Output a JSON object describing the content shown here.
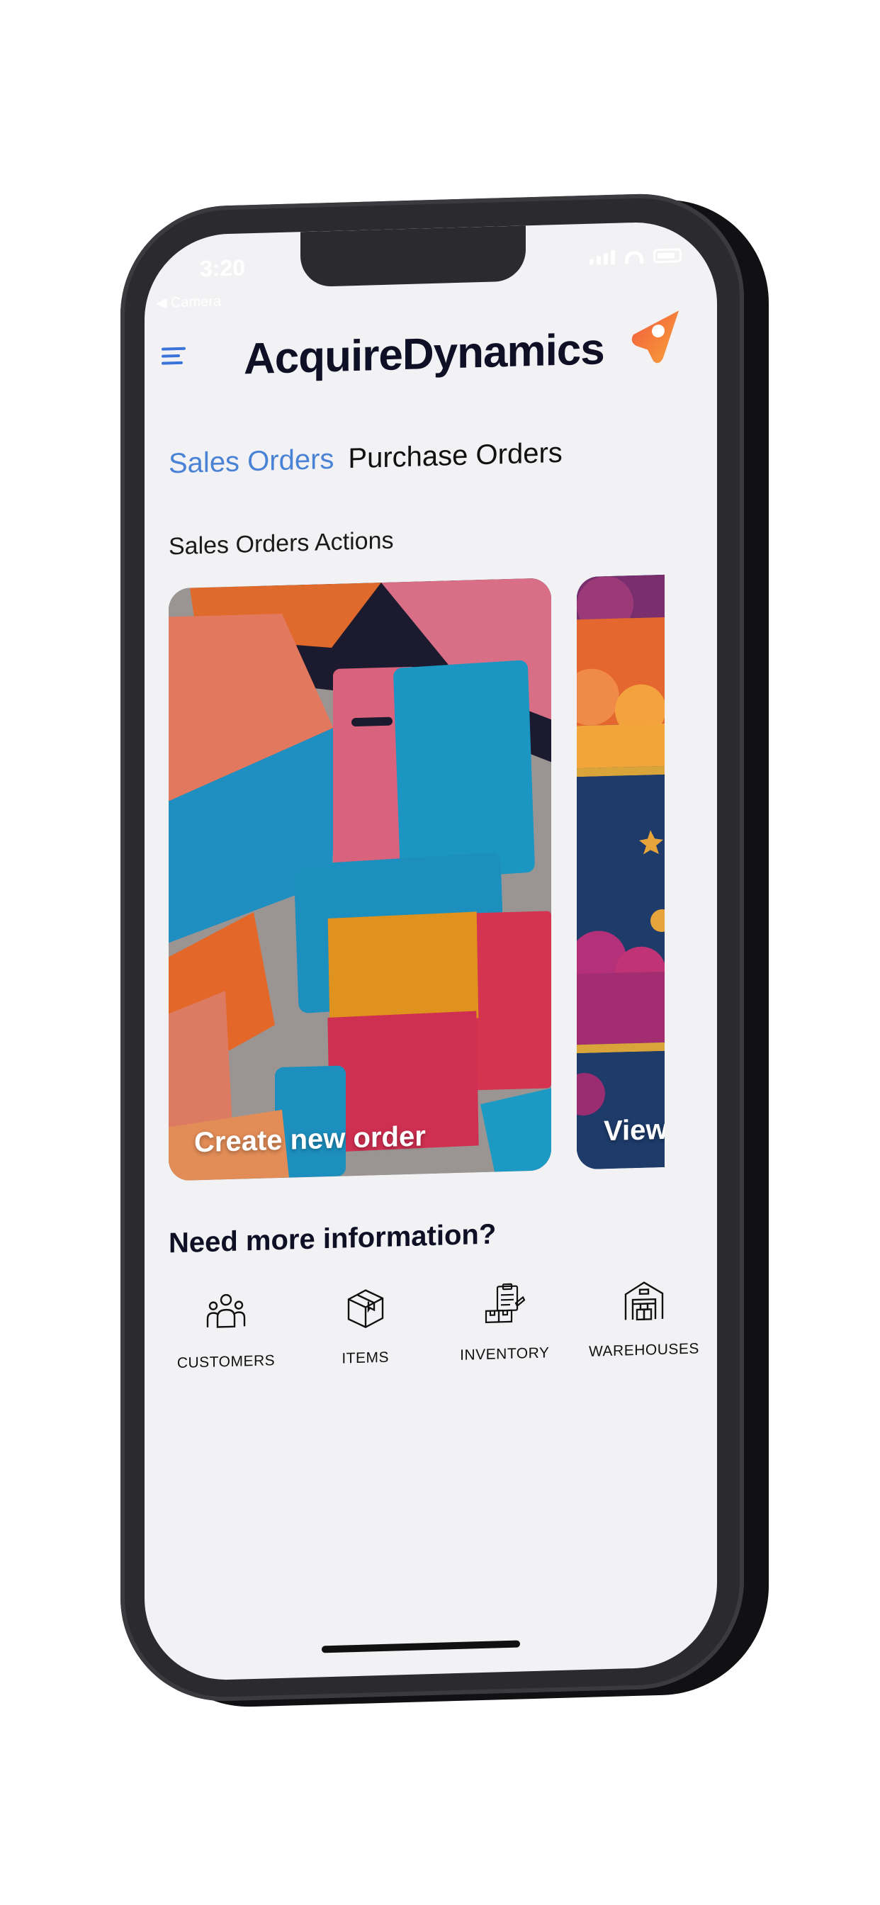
{
  "status_bar": {
    "time": "3:20",
    "back_label": "◀ Camera"
  },
  "header": {
    "app_title": "AcquireDynamics",
    "menu_icon": "hamburger-menu-icon",
    "logo_icon": "location-pin-logo-icon"
  },
  "tabs": [
    {
      "label": "Sales Orders",
      "active": true
    },
    {
      "label": "Purchase Orders",
      "active": false
    }
  ],
  "section": {
    "title": "Sales Orders Actions"
  },
  "cards": [
    {
      "label": "Create new order"
    },
    {
      "label": "View"
    }
  ],
  "info": {
    "heading": "Need more information?",
    "shortcuts": [
      {
        "label": "CUSTOMERS",
        "icon": "people-group-icon"
      },
      {
        "label": "ITEMS",
        "icon": "box-icon"
      },
      {
        "label": "INVENTORY",
        "icon": "clipboard-boxes-icon"
      },
      {
        "label": "WAREHOUSES",
        "icon": "warehouse-icon"
      }
    ]
  },
  "colors": {
    "accent": "#4a82d6",
    "title": "#0f1026",
    "screen_bg": "#f2f2f4",
    "logo_gradient_start": "#f35a3c",
    "logo_gradient_end": "#f7a23a"
  }
}
